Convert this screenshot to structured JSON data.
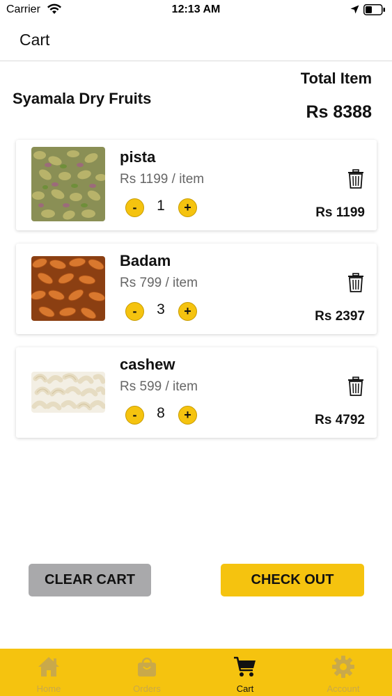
{
  "status_bar": {
    "carrier": "Carrier",
    "time": "12:13 AM"
  },
  "header": {
    "title": "Cart"
  },
  "summary": {
    "store_name": "Syamala Dry Fruits",
    "total_label": "Total Item",
    "total_value": "Rs 8388"
  },
  "items": [
    {
      "name": "pista",
      "price": "Rs 1199 / item",
      "minus": "-",
      "plus": "+",
      "quantity": "1",
      "subtotal": "Rs 1199"
    },
    {
      "name": "Badam",
      "price": "Rs 799 / item",
      "minus": "-",
      "plus": "+",
      "quantity": "3",
      "subtotal": "Rs 2397"
    },
    {
      "name": "cashew",
      "price": "Rs 599 / item",
      "minus": "-",
      "plus": "+",
      "quantity": "8",
      "subtotal": "Rs 4792"
    }
  ],
  "actions": {
    "clear_cart": "CLEAR CART",
    "check_out": "CHECK OUT"
  },
  "tab_bar": {
    "tabs": [
      {
        "label": "Home",
        "icon": "home-icon"
      },
      {
        "label": "Orders",
        "icon": "shopping-bag-icon"
      },
      {
        "label": "Cart",
        "icon": "cart-icon",
        "active": true
      },
      {
        "label": "Account",
        "icon": "gear-icon"
      }
    ]
  },
  "colors": {
    "accent": "#f5c30f",
    "button_gray": "#a9a9ab",
    "inactive_tab": "#c9a94a"
  }
}
